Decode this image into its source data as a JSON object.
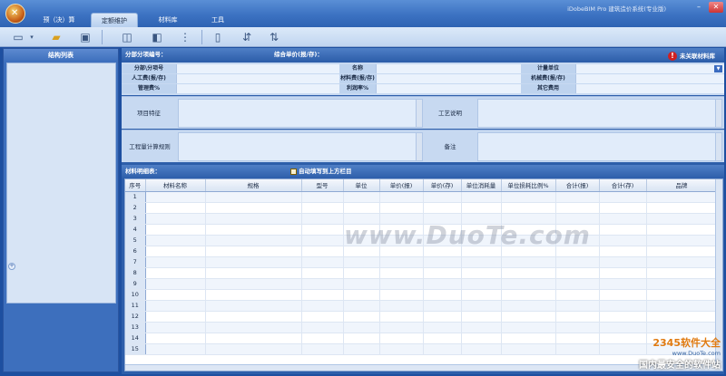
{
  "menu": {
    "items": [
      "预（决）算",
      "定额维护",
      "材料库",
      "工具"
    ],
    "active_index": 1
  },
  "window": {
    "title": "iDobeBIM Pro  建筑造价系统(专业版)",
    "min": "–",
    "close": "✕"
  },
  "toolbar": {
    "icons": [
      "new-file-icon",
      "dropdown-icon",
      "open-folder-icon",
      "save-icon",
      "tool-a-icon",
      "tool-b-icon",
      "tool-c-icon",
      "tool-d-icon",
      "tool-e-icon",
      "tool-f-icon"
    ]
  },
  "left_panel": {
    "title": "结构列表"
  },
  "info": {
    "header_left": "分部分项编号：",
    "header_mid": "综合单价(报/存)：",
    "alert": "未关联材料库",
    "row1": [
      "分部\\分项号",
      "名称",
      "计量单位"
    ],
    "row2": [
      "人工费(报/存)",
      "材料费(报/存)",
      "机械费(报/存)"
    ],
    "row3": [
      "管理费%",
      "利润率%",
      "其它费用"
    ]
  },
  "text_rows": {
    "features_label": "项目特征",
    "process_label": "工艺说明",
    "rules_label": "工程量计算规则",
    "remark_label": "备注"
  },
  "materials": {
    "header": "材料明细表：",
    "autofill": "自动填写到上方栏目",
    "columns": [
      "序号",
      "材料名称",
      "规格",
      "型号",
      "单位",
      "单价(报)",
      "单价(存)",
      "单位消耗量",
      "单位损耗比例%",
      "合计(报)",
      "合计(存)",
      "品牌"
    ],
    "rows": [
      "1",
      "2",
      "3",
      "4",
      "5",
      "6",
      "7",
      "8",
      "9",
      "10",
      "11",
      "12",
      "13",
      "14",
      "15"
    ]
  },
  "watermarks": {
    "center": "www.DuoTe.com",
    "brand": "2345软件大全",
    "site": "www.DuoTe.com",
    "slogan": "国内最安全的软件站"
  }
}
